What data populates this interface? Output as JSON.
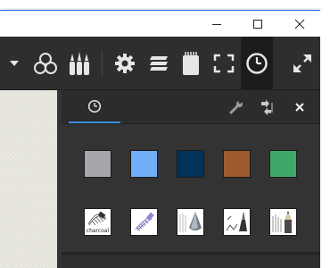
{
  "window": {
    "caption_buttons": [
      "minimize-icon",
      "maximize-icon",
      "close-icon"
    ]
  },
  "toolbar": {
    "icons": [
      "dropdown-caret-icon",
      "color-circles-icon",
      "brushes-icon",
      "settings-gear-icon",
      "layers-icon",
      "sketchbook-icon",
      "fullscreen-icon",
      "clock-icon",
      "expand-icon"
    ],
    "active_icon": "clock-icon"
  },
  "panel": {
    "active_tab_icon": "clock-icon",
    "controls": [
      "wrench-icon",
      "swap-icon",
      "close-icon"
    ],
    "recent_colors": [
      "#a7a6ab",
      "#73aef8",
      "#02325a",
      "#9d5b2d",
      "#3fa868"
    ],
    "recent_tools": [
      {
        "icon": "charcoal-brush-icon",
        "label": "charcoal"
      },
      {
        "icon": "purple-chalk-brush-icon",
        "label": ""
      },
      {
        "icon": "airbrush-cone-icon",
        "label": ""
      },
      {
        "icon": "ink-pen-icon",
        "label": ""
      },
      {
        "icon": "pencil-icon",
        "label": ""
      }
    ]
  }
}
